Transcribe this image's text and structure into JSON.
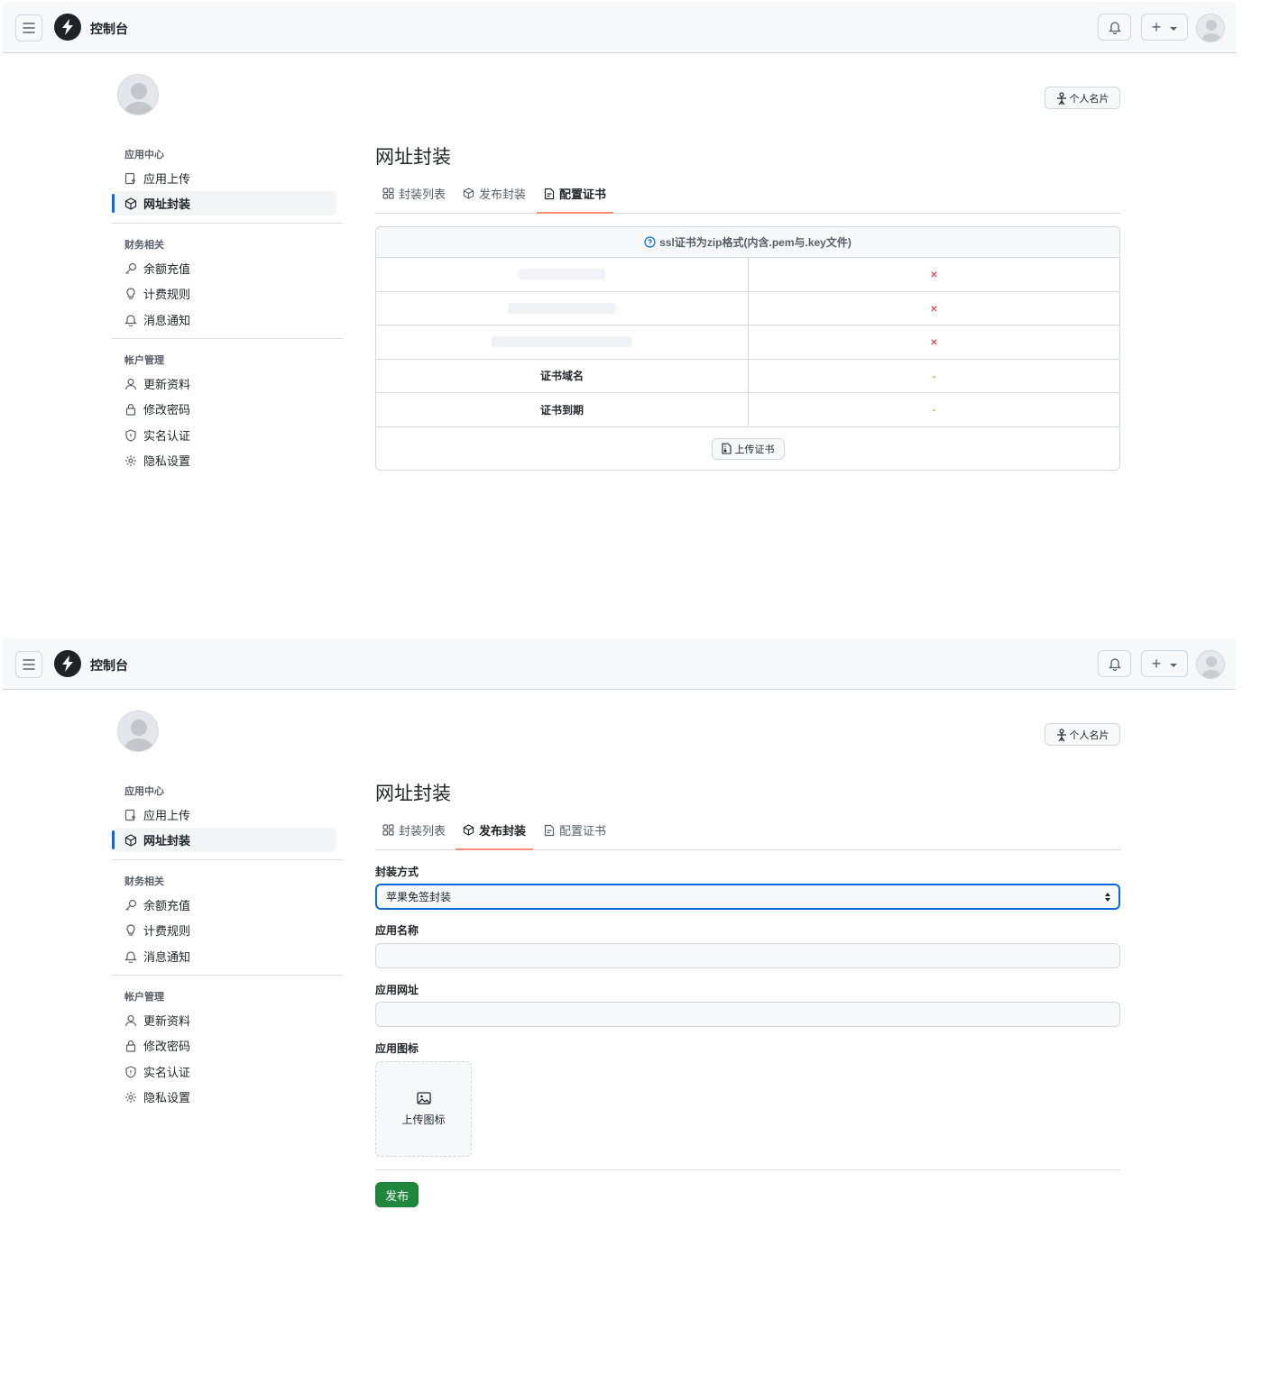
{
  "header": {
    "brand": "控制台"
  },
  "profile": {
    "card_button": "个人名片"
  },
  "sidebar": {
    "groups": [
      {
        "title": "应用中心",
        "items": [
          {
            "label": "应用上传"
          },
          {
            "label": "网址封装",
            "active": true
          }
        ]
      },
      {
        "title": "财务相关",
        "items": [
          {
            "label": "余额充值"
          },
          {
            "label": "计费规则"
          },
          {
            "label": "消息通知"
          }
        ]
      },
      {
        "title": "帐户管理",
        "items": [
          {
            "label": "更新资料"
          },
          {
            "label": "修改密码"
          },
          {
            "label": "实名认证"
          },
          {
            "label": "隐私设置"
          }
        ]
      }
    ]
  },
  "page": {
    "title": "网址封装",
    "tabs": [
      {
        "label": "封装列表"
      },
      {
        "label": "发布封装"
      },
      {
        "label": "配置证书"
      }
    ]
  },
  "cert": {
    "notice": "ssl证书为zip格式(内含.pem与.key文件)",
    "rows": [
      {
        "value": "×"
      },
      {
        "value": "×"
      },
      {
        "value": "×"
      },
      {
        "label": "证书域名",
        "value": "-"
      },
      {
        "label": "证书到期",
        "value": "-"
      }
    ],
    "upload_button": "上传证书"
  },
  "publish_form": {
    "method_label": "封装方式",
    "method_value": "苹果免签封装",
    "name_label": "应用名称",
    "name_value": "",
    "url_label": "应用网址",
    "url_value": "",
    "icon_label": "应用图标",
    "icon_upload": "上传图标",
    "submit": "发布"
  },
  "colors": {
    "accent": "#0969da",
    "tab_underline": "#fd8c73",
    "primary_button": "#1f883d",
    "error": "#cf222e",
    "warning": "#bf8700"
  }
}
